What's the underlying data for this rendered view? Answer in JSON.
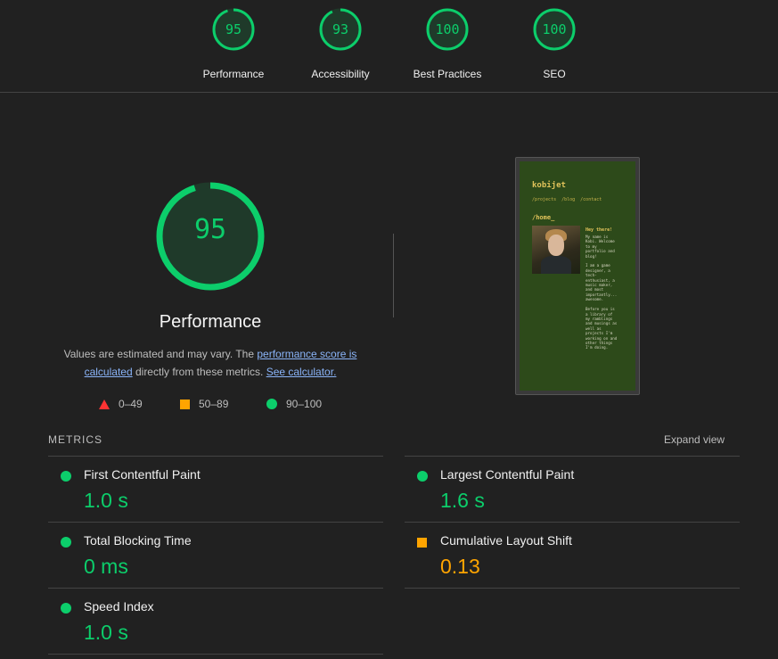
{
  "top_scores": [
    {
      "score": "95",
      "label": "Performance",
      "fraction": 0.95
    },
    {
      "score": "93",
      "label": "Accessibility",
      "fraction": 0.93
    },
    {
      "score": "100",
      "label": "Best Practices",
      "fraction": 1.0
    },
    {
      "score": "100",
      "label": "SEO",
      "fraction": 1.0
    }
  ],
  "performance": {
    "score": "95",
    "fraction": 0.95,
    "title": "Performance",
    "desc_prefix": "Values are estimated and may vary. The ",
    "desc_link1": "performance score is calculated",
    "desc_mid": " directly from these metrics. ",
    "desc_link2": "See calculator."
  },
  "legend": [
    {
      "icon": "triangle-icon",
      "range": "0–49",
      "color": "#ff3333"
    },
    {
      "icon": "square-icon",
      "range": "50–89",
      "color": "#ffa400"
    },
    {
      "icon": "circle-icon",
      "range": "90–100",
      "color": "#0cce6b"
    }
  ],
  "thumbnail": {
    "brand": "kobijet",
    "nav": "/projects /blog /contact",
    "heading": "/home_",
    "greeting": "Hey there!",
    "body": "My name is\nKobi. Welcome\nto my\nportfolio and\nblog!\n\nI am a game\ndesigner, a\ntech-\nenthusiast, a\nmusic maker,\nand most\nimportantly...\nawesome.\n\nBefore you is\na library of\nmy ramblings\nand musings as\nwell as\nprojects I'm\nworking on and\nother things\nI'm doing."
  },
  "metrics": {
    "heading": "METRICS",
    "expand_label": "Expand view",
    "items": [
      {
        "name": "First Contentful Paint",
        "value": "1.0 s",
        "status": "good"
      },
      {
        "name": "Largest Contentful Paint",
        "value": "1.6 s",
        "status": "good"
      },
      {
        "name": "Total Blocking Time",
        "value": "0 ms",
        "status": "good"
      },
      {
        "name": "Cumulative Layout Shift",
        "value": "0.13",
        "status": "average"
      },
      {
        "name": "Speed Index",
        "value": "1.0 s",
        "status": "good"
      }
    ]
  },
  "colors": {
    "good": "#0cce6b",
    "average": "#ffa400",
    "poor": "#ff3333"
  }
}
